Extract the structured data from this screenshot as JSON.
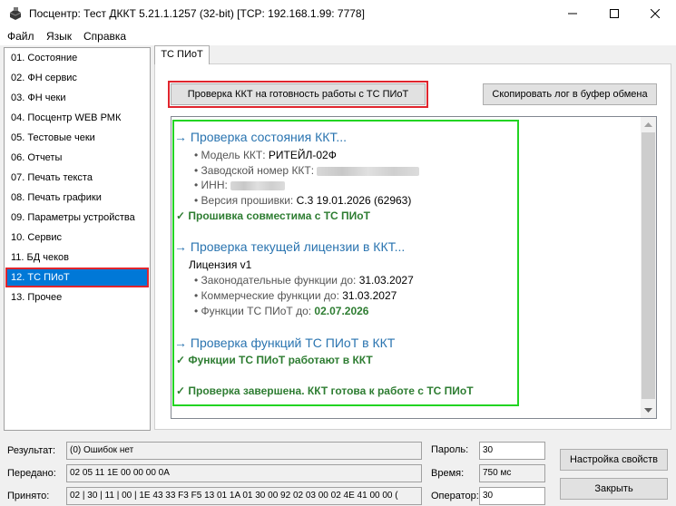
{
  "window": {
    "title": "Посцентр: Тест ДККТ 5.21.1.1257 (32-bit) [TCP: 192.168.1.99: 7778]",
    "icons": [
      "app-printer-icon",
      "minimize-icon",
      "maximize-icon",
      "close-icon"
    ]
  },
  "menu": {
    "file": "Файл",
    "language": "Язык",
    "help": "Справка"
  },
  "sidebar": {
    "items": [
      {
        "label": "01. Состояние"
      },
      {
        "label": "02. ФН сервис"
      },
      {
        "label": "03. ФН чеки"
      },
      {
        "label": "04. Посцентр WEB РМК"
      },
      {
        "label": "05. Тестовые чеки"
      },
      {
        "label": "06. Отчеты"
      },
      {
        "label": "07. Печать текста"
      },
      {
        "label": "08. Печать графики"
      },
      {
        "label": "09. Параметры устройства"
      },
      {
        "label": "10. Сервис"
      },
      {
        "label": "11. БД чеков"
      },
      {
        "label": "12. ТС ПИоТ"
      },
      {
        "label": "13. Прочее"
      }
    ],
    "selected": "12. ТС ПИоТ"
  },
  "tab": {
    "label": "ТС ПИоТ"
  },
  "buttons": {
    "check": "Проверка ККТ на готовность работы с ТС ПИоТ",
    "copy_log": "Скопировать лог в буфер обмена",
    "settings": "Настройка свойств",
    "close": "Закрыть"
  },
  "log": {
    "h1": "→ Проверка состояния ККТ...",
    "model_label": "• Модель ККТ: ",
    "model_value": "РИТЕЙЛ-02Ф",
    "serial_label": "• Заводской номер ККТ: ",
    "inn_label": "• ИНН: ",
    "fw_label": "• Версия прошивки: ",
    "fw_value": "С.3 19.01.2026 (62963)",
    "fw_ok": "✓  Прошивка совместима с ТС ПИоТ",
    "h2": "→ Проверка текущей лицензии в ККТ...",
    "license": "Лицензия v1",
    "legal_label": "• Законодательные функции до: ",
    "legal_value": "31.03.2027",
    "commercial_label": "• Коммерческие функции до: ",
    "commercial_value": "31.03.2027",
    "tspiot_label": "• Функции ТС ПИоТ до: ",
    "tspiot_value": "02.07.2026",
    "h3": "→ Проверка функций ТС ПИоТ в ККТ",
    "func_ok": "✓  Функции ТС ПИоТ работают в ККТ",
    "done": "✓  Проверка завершена. ККТ готова к работе с ТС ПИоТ"
  },
  "status": {
    "result_label": "Результат:",
    "result_value": "(0) Ошибок нет",
    "sent_label": "Передано:",
    "sent_value": "02 05 11 1E 00 00 00 0A",
    "received_label": "Принято:",
    "received_value": "02 | 30 | 11 | 00 | 1E 43 33 F3 F5 13 01 1A 01 30 00 92 02 03 00 02 4E 41 00 00 (",
    "password_label": "Пароль:",
    "password_value": "30",
    "time_label": "Время:",
    "time_value": "750 мс",
    "operator_label": "Оператор:",
    "operator_value": "30"
  }
}
